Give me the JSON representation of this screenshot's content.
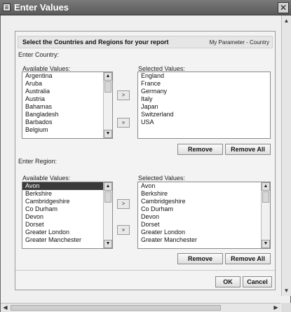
{
  "window": {
    "title": "Enter Values",
    "close_glyph": "✕"
  },
  "header": {
    "title": "Select the Countries and Regions for your report",
    "parameter": "My Parameter - Country"
  },
  "country": {
    "section_label": "Enter Country:",
    "available_label": "Available Values:",
    "selected_label": "Selected Values:",
    "available": [
      "Argentina",
      "Aruba",
      "Australia",
      "Austria",
      "Bahamas",
      "Bangladesh",
      "Barbados",
      "Belgium"
    ],
    "selected": [
      "England",
      "France",
      "Germany",
      "Italy",
      "Japan",
      "Switzerland",
      "USA"
    ],
    "move_one": ">",
    "move_all": "»",
    "remove": "Remove",
    "remove_all": "Remove All"
  },
  "region": {
    "section_label": "Enter Region:",
    "available_label": "Available Values:",
    "selected_label": "Selected Values:",
    "available": [
      "Avon",
      "Berkshire",
      "Cambridgeshire",
      "Co Durham",
      "Devon",
      "Dorset",
      "Greater London",
      "Greater Manchester"
    ],
    "selected": [
      "Avon",
      "Berkshire",
      "Cambridgeshire",
      "Co Durham",
      "Devon",
      "Dorset",
      "Greater London",
      "Greater Manchester"
    ],
    "highlighted_available": "Avon",
    "move_one": ">",
    "move_all": "»",
    "remove": "Remove",
    "remove_all": "Remove All"
  },
  "footer": {
    "ok": "OK",
    "cancel": "Cancel"
  },
  "scroll": {
    "up": "▲",
    "down": "▼",
    "left": "◀",
    "right": "▶"
  },
  "icons": [
    "window-icon",
    "close-icon",
    "scroll-up-icon",
    "scroll-down-icon",
    "scroll-left-icon",
    "scroll-right-icon"
  ]
}
